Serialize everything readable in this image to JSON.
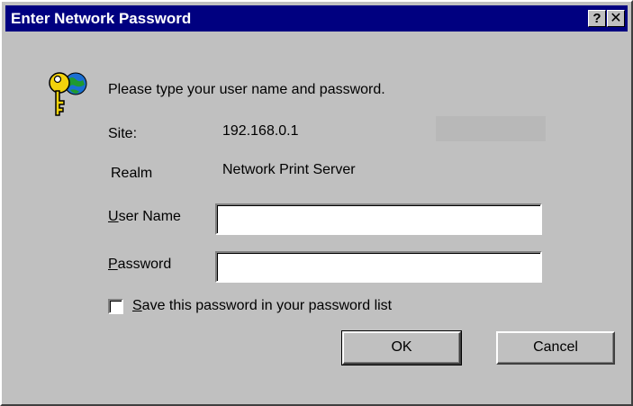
{
  "window": {
    "title": "Enter Network Password",
    "help_label": "?",
    "close_label": "✕"
  },
  "prompt": "Please type your user name and password.",
  "site": {
    "label": "Site:",
    "value": "192.168.0.1"
  },
  "realm": {
    "label": "Realm",
    "value": "Network Print Server"
  },
  "user_name": {
    "label_mnemonic": "U",
    "label_rest": "ser Name",
    "value": ""
  },
  "password": {
    "label_mnemonic": "P",
    "label_rest": "assword",
    "value": ""
  },
  "save_password": {
    "label_mnemonic": "S",
    "label_rest": "ave this password in your password list",
    "checked": false
  },
  "buttons": {
    "ok": "OK",
    "cancel": "Cancel"
  },
  "icon": "key-icon",
  "colors": {
    "titlebar": "#000080",
    "face": "#c0c0c0"
  }
}
